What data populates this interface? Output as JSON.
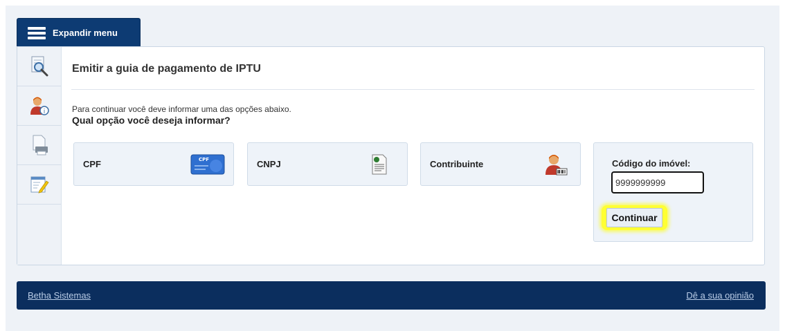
{
  "menu": {
    "expand_label": "Expandir menu"
  },
  "sidebar": {
    "items": [
      {
        "icon": "search-document-icon"
      },
      {
        "icon": "user-info-icon"
      },
      {
        "icon": "printer-document-icon"
      },
      {
        "icon": "edit-document-icon"
      }
    ]
  },
  "main": {
    "title": "Emitir a guia de pagamento de IPTU",
    "intro": "Para continuar você deve informar uma das opções abaixo.",
    "question": "Qual opção você deseja informar?",
    "options": [
      {
        "label": "CPF",
        "icon": "cpf-card-icon",
        "card_text": "CPF"
      },
      {
        "label": "CNPJ",
        "icon": "certificate-document-icon"
      },
      {
        "label": "Contribuinte",
        "icon": "taxpayer-barcode-icon"
      }
    ],
    "code": {
      "label": "Código do imóvel:",
      "value": "9999999999",
      "button_label": "Continuar"
    }
  },
  "footer": {
    "left_link": "Betha Sistemas",
    "right_link": "Dê a sua opinião"
  },
  "colors": {
    "navy": "#0d3b73",
    "footer": "#0b2e5e",
    "highlight": "#ffff33",
    "option_bg": "#eef3f9"
  }
}
